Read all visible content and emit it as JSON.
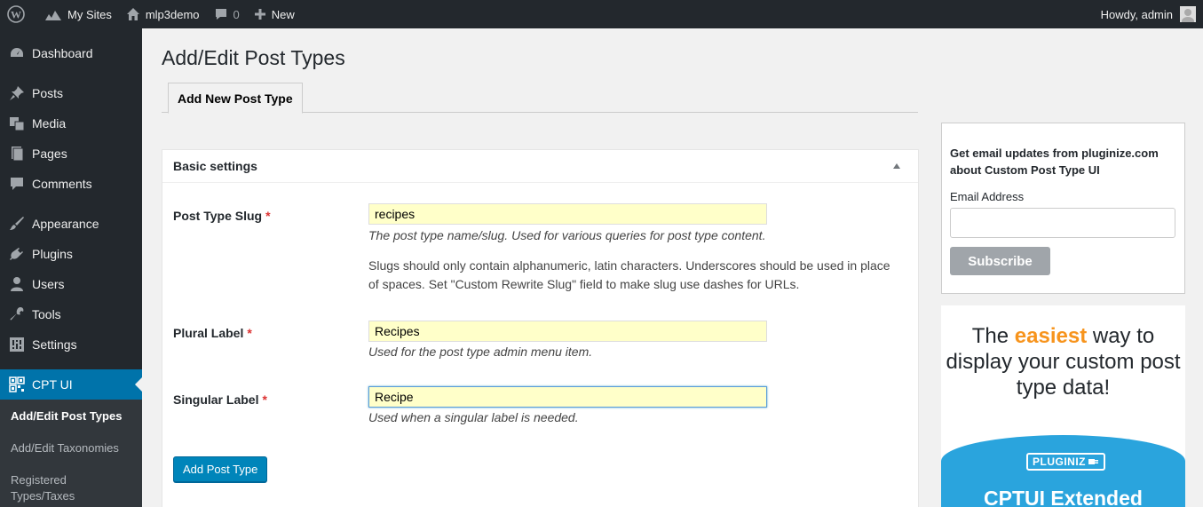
{
  "adminbar": {
    "my_sites": "My Sites",
    "site_name": "mlp3demo",
    "comments_count": "0",
    "new_label": "New",
    "greeting": "Howdy, admin"
  },
  "sidebar": {
    "items": [
      {
        "label": "Dashboard"
      },
      {
        "label": "Posts"
      },
      {
        "label": "Media"
      },
      {
        "label": "Pages"
      },
      {
        "label": "Comments"
      },
      {
        "label": "Appearance"
      },
      {
        "label": "Plugins"
      },
      {
        "label": "Users"
      },
      {
        "label": "Tools"
      },
      {
        "label": "Settings"
      },
      {
        "label": "CPT UI"
      }
    ],
    "submenu": [
      {
        "label": "Add/Edit Post Types"
      },
      {
        "label": "Add/Edit Taxonomies"
      },
      {
        "label": "Registered Types/Taxes"
      }
    ]
  },
  "main": {
    "title": "Add/Edit Post Types",
    "tab_label": "Add New Post Type",
    "section_title": "Basic settings",
    "fields": {
      "slug": {
        "label": "Post Type Slug",
        "required": "*",
        "value": "recipes",
        "description": "The post type name/slug. Used for various queries for post type content.",
        "note": "Slugs should only contain alphanumeric, latin characters. Underscores should be used in place of spaces. Set \"Custom Rewrite Slug\" field to make slug use dashes for URLs."
      },
      "plural": {
        "label": "Plural Label",
        "required": "*",
        "value": "Recipes",
        "description": "Used for the post type admin menu item."
      },
      "singular": {
        "label": "Singular Label",
        "required": "*",
        "value": "Recipe",
        "description": "Used when a singular label is needed."
      }
    },
    "submit_label": "Add Post Type"
  },
  "widget": {
    "title": "Get email updates from pluginize.com about Custom Post Type UI",
    "email_label": "Email Address",
    "email_value": "",
    "subscribe_label": "Subscribe"
  },
  "ad": {
    "text_before": "The",
    "highlight": "easiest",
    "text_after": "way to display your custom post type data!",
    "brand": "PLUGINIZ",
    "product": "CPTUI Extended"
  },
  "colors": {
    "accent": "#0073aa",
    "button": "#0085ba",
    "adminbar": "#23282d",
    "highlight": "#f7941d",
    "required": "#dc3232",
    "input_autofill": "#ffffc9"
  }
}
